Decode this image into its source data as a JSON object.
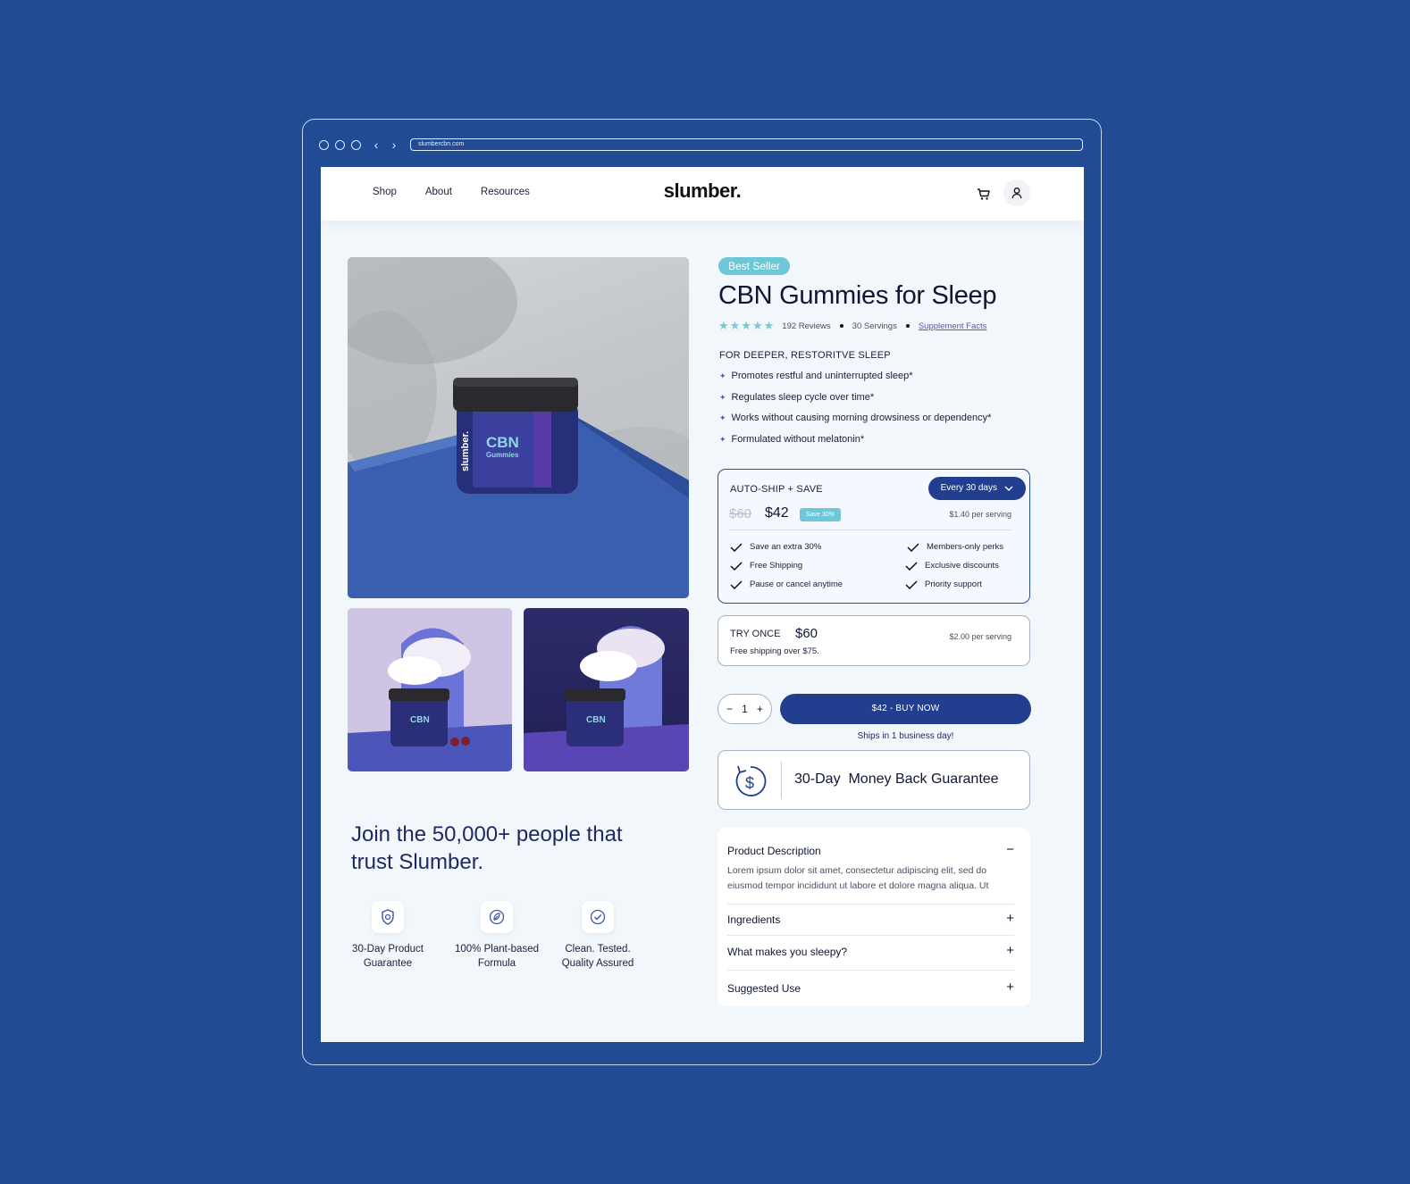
{
  "browser": {
    "url": "slumbercbn.com"
  },
  "header": {
    "nav": [
      "Shop",
      "About",
      "Resources"
    ],
    "logo": "slumber."
  },
  "product": {
    "badge": "Best Seller",
    "title": "CBN Gummies for Sleep",
    "rating_stars": 5,
    "reviews": "192 Reviews",
    "servings": "30 Servings",
    "facts_link": "Supplement Facts",
    "subhead": "FOR DEEPER, RESTORITVE SLEEP",
    "benefits": [
      "Promotes restful and uninterrupted sleep*",
      "Regulates sleep cycle over time*",
      "Works without causing morning drowsiness or dependency*",
      "Formulated without melatonin*"
    ]
  },
  "autoship": {
    "title": "AUTO-SHIP + SAVE",
    "frequency": "Every 30 days",
    "old_price": "$60",
    "price": "$42",
    "save_badge": "Save 30%",
    "per_serving": "$1.40 per serving",
    "perks_left": [
      "Save an extra 30%",
      "Free Shipping",
      "Pause or cancel anytime"
    ],
    "perks_right": [
      "Members-only perks",
      "Exclusive discounts",
      "Priority support"
    ]
  },
  "try_once": {
    "title": "TRY ONCE",
    "price": "$60",
    "shipping": "Free shipping over $75.",
    "per_serving": "$2.00 per serving"
  },
  "purchase": {
    "qty_minus": "−",
    "quantity": "1",
    "qty_plus": "+",
    "buy_label": "$42 - BUY NOW",
    "ships_note": "Ships in 1 business day!"
  },
  "guarantee": {
    "text": "30-Day  Money Back Guarantee"
  },
  "accordion": {
    "open": {
      "title": "Product Description",
      "sign": "−",
      "body": "Lorem ipsum dolor sit amet, consectetur adipiscing elit, sed do eiusmod tempor incididunt ut labore et dolore magna aliqua. Ut"
    },
    "items": [
      {
        "title": "Ingredients",
        "sign": "+"
      },
      {
        "title": "What makes you sleepy?",
        "sign": "+"
      },
      {
        "title": "Suggested Use",
        "sign": "+"
      }
    ]
  },
  "trust": {
    "heading": "Join the 50,000+ people that trust Slumber.",
    "items": [
      {
        "label": "30-Day Product Guarantee",
        "icon": "shield-icon"
      },
      {
        "label": "100% Plant-based Formula",
        "icon": "leaf-icon"
      },
      {
        "label": "Clean. Tested. Quality Assured",
        "icon": "check-circle-icon"
      }
    ]
  },
  "jar_label": {
    "brand": "slumber.",
    "line1": "CBN",
    "line2": "Gummies"
  },
  "colors": {
    "page_bg": "#214b93",
    "primary": "#213f8e",
    "accent_teal": "#6dc7d7",
    "accent_purple": "#6a4bb8"
  }
}
